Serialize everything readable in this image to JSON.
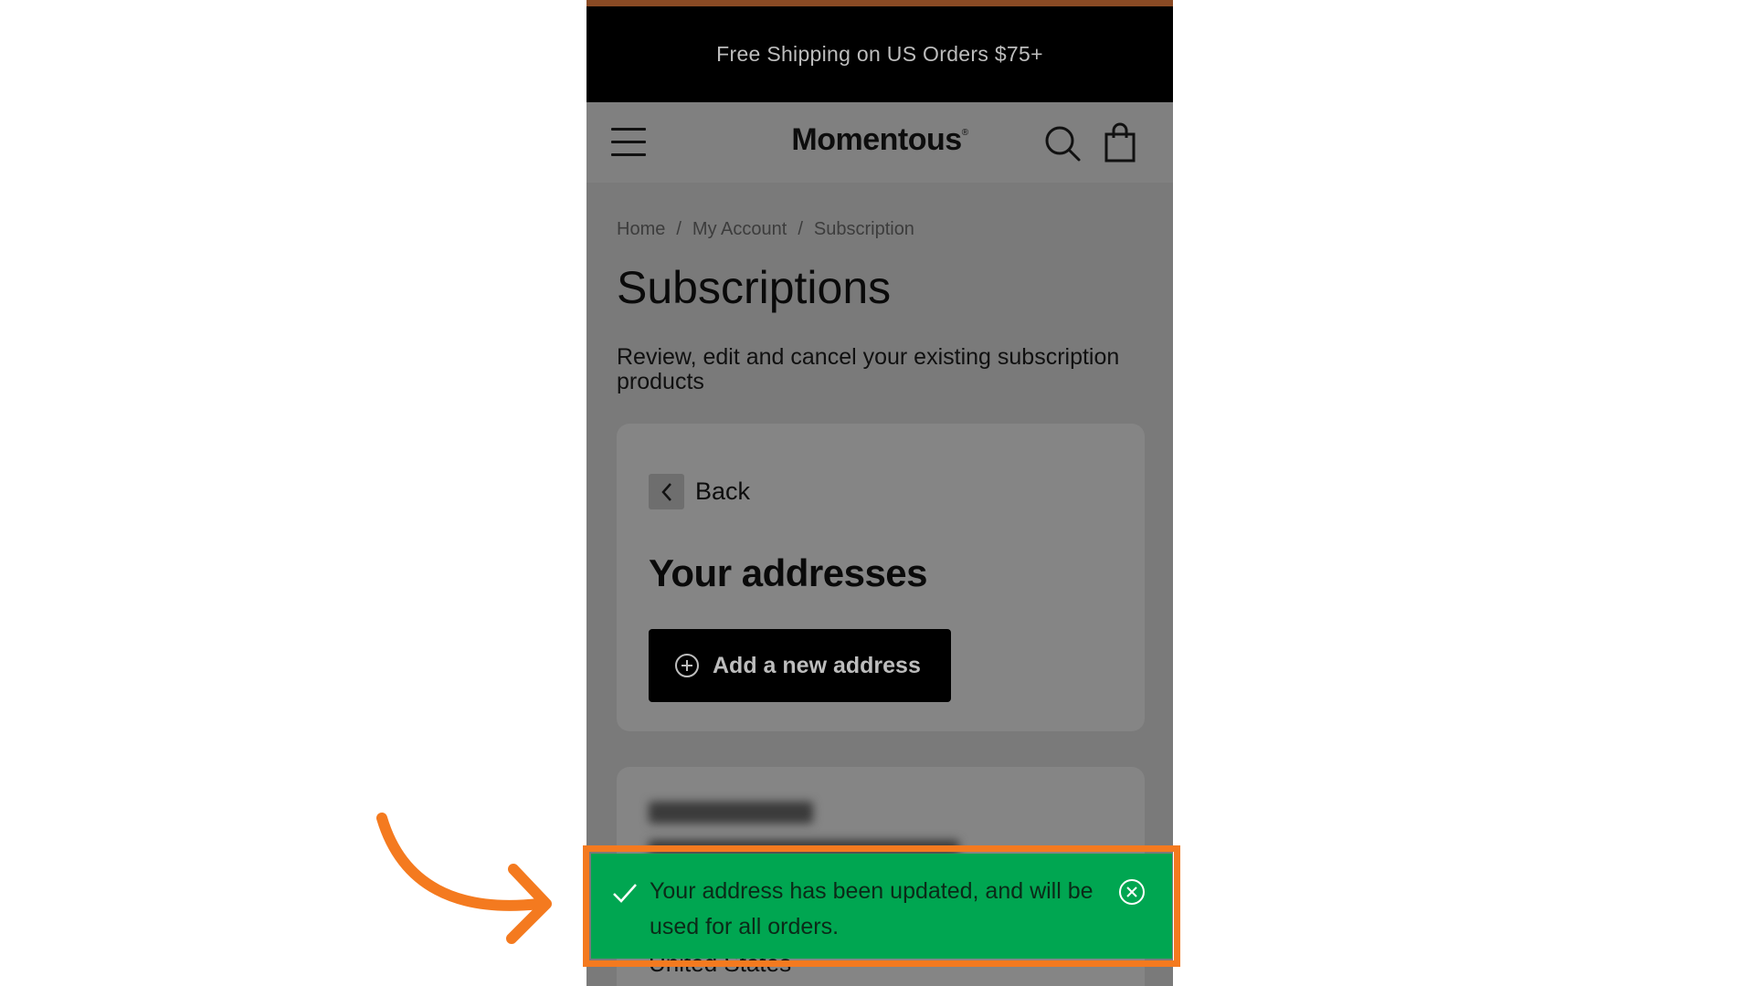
{
  "promo": {
    "text": "Free Shipping on US Orders $75+"
  },
  "header": {
    "logo": "Momentous",
    "logo_mark": "®"
  },
  "breadcrumb": [
    {
      "label": "Home"
    },
    {
      "label": "My Account"
    },
    {
      "label": "Subscription"
    }
  ],
  "page": {
    "title": "Subscriptions",
    "description": "Review, edit and cancel your existing subscription products"
  },
  "addresses": {
    "back_label": "Back",
    "title": "Your addresses",
    "add_button": "Add a new address"
  },
  "address_card": {
    "country": "United States"
  },
  "toast": {
    "message": "Your address has been updated, and will be used for all orders."
  },
  "colors": {
    "toast_bg": "#00a651",
    "highlight": "#f47a1f",
    "overlay": "#7a7a7a"
  },
  "icons": {
    "menu": "menu-icon",
    "search": "search-icon",
    "bag": "bag-icon",
    "back": "chevron-left-icon",
    "add": "plus-circle-icon",
    "check": "check-icon",
    "close": "close-circle-icon",
    "annotation": "arrow-icon"
  }
}
